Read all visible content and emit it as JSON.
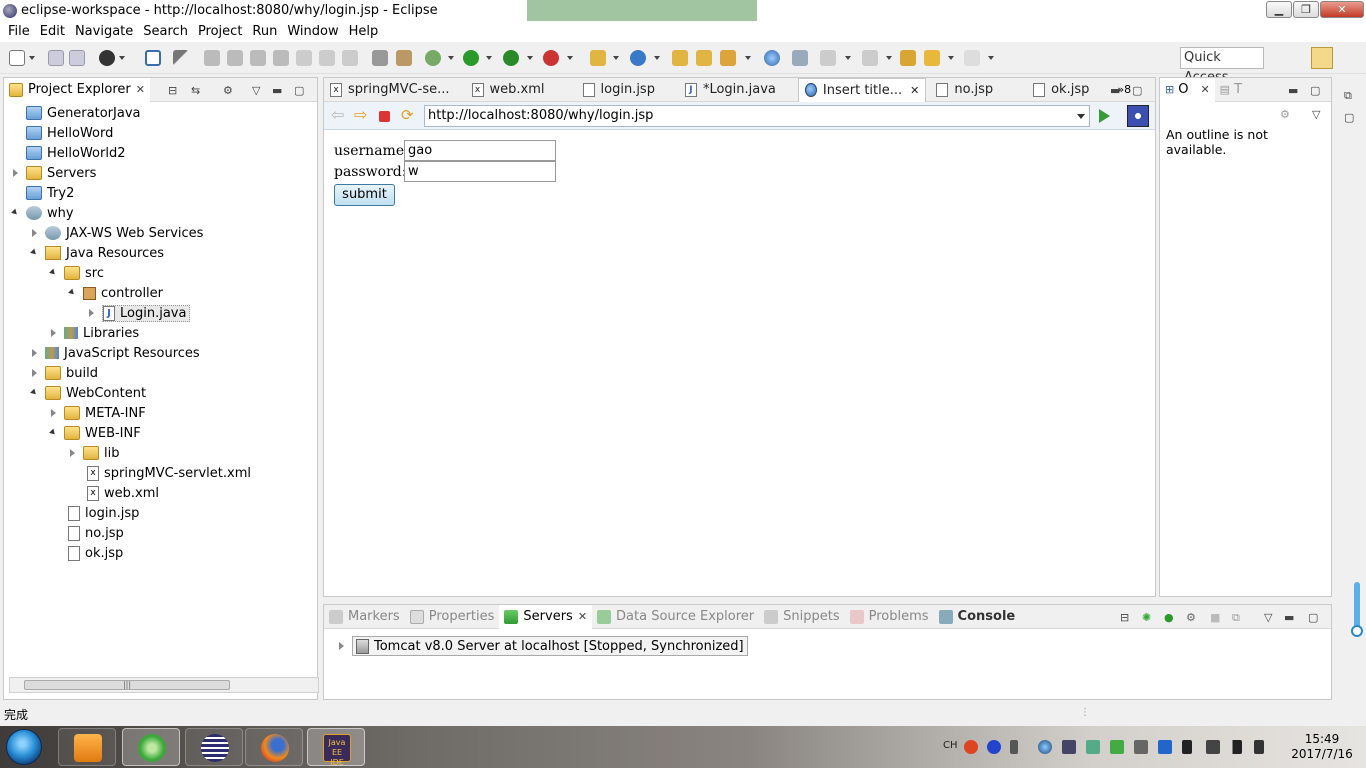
{
  "window": {
    "title": "eclipse-workspace - http://localhost:8080/why/login.jsp - Eclipse",
    "controls": [
      "minimize",
      "maximize",
      "close"
    ]
  },
  "menubar": {
    "items": [
      "File",
      "Edit",
      "Navigate",
      "Search",
      "Project",
      "Run",
      "Window",
      "Help"
    ]
  },
  "toolbar": {
    "quick_access": "Quick Access"
  },
  "project_explorer": {
    "tab_label": "Project Explorer",
    "items": [
      {
        "label": "GeneratorJava",
        "icon": "project-icon"
      },
      {
        "label": "HelloWord",
        "icon": "project-icon"
      },
      {
        "label": "HelloWorld2",
        "icon": "project-icon"
      },
      {
        "label": "Servers",
        "icon": "folder-icon"
      },
      {
        "label": "Try2",
        "icon": "project-icon"
      },
      {
        "label": "why",
        "icon": "web-project-icon"
      },
      {
        "label": "JAX-WS Web Services",
        "icon": "webservices-icon"
      },
      {
        "label": "Java Resources",
        "icon": "java-resources-icon"
      },
      {
        "label": "src",
        "icon": "source-folder-icon"
      },
      {
        "label": "controller",
        "icon": "package-icon"
      },
      {
        "label": "Login.java",
        "icon": "java-file-icon"
      },
      {
        "label": "Libraries",
        "icon": "libraries-icon"
      },
      {
        "label": "JavaScript Resources",
        "icon": "javascript-resources-icon"
      },
      {
        "label": "build",
        "icon": "folder-icon"
      },
      {
        "label": "WebContent",
        "icon": "folder-icon"
      },
      {
        "label": "META-INF",
        "icon": "folder-icon"
      },
      {
        "label": "WEB-INF",
        "icon": "folder-icon"
      },
      {
        "label": "lib",
        "icon": "folder-icon"
      },
      {
        "label": "springMVC-servlet.xml",
        "icon": "xml-file-icon"
      },
      {
        "label": "web.xml",
        "icon": "xml-file-icon"
      },
      {
        "label": "login.jsp",
        "icon": "jsp-file-icon"
      },
      {
        "label": "no.jsp",
        "icon": "jsp-file-icon"
      },
      {
        "label": "ok.jsp",
        "icon": "jsp-file-icon"
      }
    ]
  },
  "editor": {
    "tabs": [
      {
        "label": "springMVC-se...",
        "icon": "xml-file-icon"
      },
      {
        "label": "web.xml",
        "icon": "xml-file-icon"
      },
      {
        "label": "login.jsp",
        "icon": "jsp-file-icon"
      },
      {
        "label": "*Login.java",
        "icon": "java-file-icon"
      },
      {
        "label": "Insert title...",
        "icon": "globe-icon",
        "active": true
      },
      {
        "label": "no.jsp",
        "icon": "jsp-file-icon"
      },
      {
        "label": "ok.jsp",
        "icon": "jsp-file-icon"
      }
    ],
    "overflow_count": "»8",
    "url": "http://localhost:8080/why/login.jsp",
    "form": {
      "username_label": "username:",
      "username_value": "gao",
      "password_label": "password:",
      "password_value": "w",
      "submit_label": "submit"
    }
  },
  "outline": {
    "tab_label": "O",
    "second_tab_label": "T",
    "message": "An outline is not available."
  },
  "bottom_panel": {
    "tabs": [
      {
        "label": "Markers",
        "icon": "markers-icon"
      },
      {
        "label": "Properties",
        "icon": "properties-icon"
      },
      {
        "label": "Servers",
        "icon": "servers-icon",
        "active": true
      },
      {
        "label": "Data Source Explorer",
        "icon": "datasource-icon"
      },
      {
        "label": "Snippets",
        "icon": "snippets-icon"
      },
      {
        "label": "Problems",
        "icon": "problems-icon"
      },
      {
        "label": "Console",
        "icon": "console-icon"
      }
    ],
    "server_entry": "Tomcat v8.0 Server at localhost  [Stopped, Synchronized]"
  },
  "statusbar": {
    "text": "完成"
  },
  "taskbar": {
    "apps": [
      "Windows Media Player",
      "Browser",
      "Eclipse",
      "Firefox",
      "Java EE IDE"
    ],
    "java_ee_label": "Java EE IDE",
    "tray_language": "CH",
    "time": "15:49",
    "date": "2017/7/16"
  }
}
